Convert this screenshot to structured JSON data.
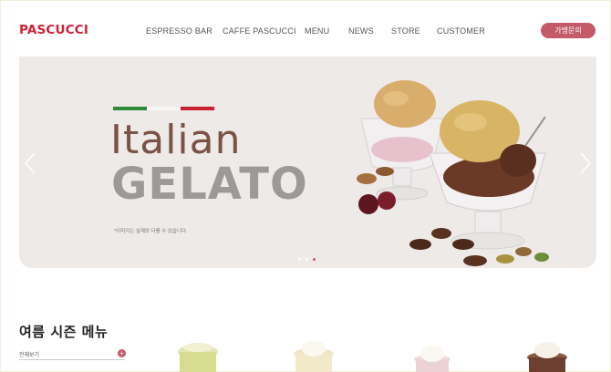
{
  "header": {
    "logo": "PASCUCCI",
    "nav": [
      {
        "label": "ESPRESSO BAR"
      },
      {
        "label": "CAFFE PASCUCCI"
      },
      {
        "label": "MENU"
      },
      {
        "label": "NEWS"
      },
      {
        "label": "STORE"
      },
      {
        "label": "CUSTOMER"
      }
    ],
    "cta_label": "가맹문의"
  },
  "hero": {
    "title_line1": "Italian",
    "title_line2": "GELATO",
    "subtitle": "*이미지는 실제와 다를 수 있습니다.",
    "slide_count": 3,
    "active_slide": 3,
    "prev_icon": "chevron-left-icon",
    "next_icon": "chevron-right-icon",
    "flag_colors": [
      "#2e8b3a",
      "#f7f7f7",
      "#c8202f"
    ]
  },
  "section": {
    "title": "여름 시즌 메뉴",
    "view_all": "전체보기",
    "plus_icon": "plus-icon"
  },
  "colors": {
    "brand": "#d11f36",
    "accent": "#c35a6a",
    "hero_bg": "#eeeae7"
  }
}
